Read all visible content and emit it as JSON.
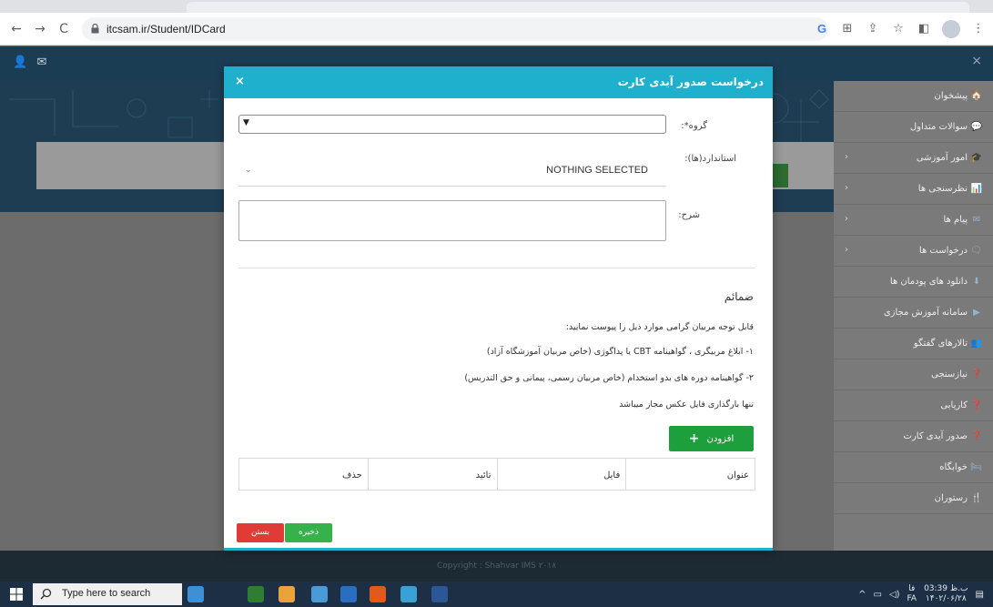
{
  "browser": {
    "url": "itcsam.ir/Student/IDCard",
    "nav": {
      "back": "←",
      "forward": "→",
      "reload": "C"
    },
    "toolbar_icons": [
      "G",
      "⊞",
      "⇪",
      "☆",
      "◧",
      "",
      "⋮"
    ]
  },
  "header": {
    "icons": [
      "👤",
      "✉"
    ]
  },
  "sidebar": {
    "close": "×",
    "items": [
      {
        "label": "پیشخوان",
        "icon": "home-icon",
        "glyph": "🏠",
        "chevron": ""
      },
      {
        "label": "سوالات متداول",
        "icon": "chat-icon",
        "glyph": "💬",
        "chevron": ""
      },
      {
        "label": "امور آموزشی",
        "icon": "graduation-icon",
        "glyph": "🎓",
        "chevron": "‹"
      },
      {
        "label": "نظرسنجی ها",
        "icon": "bar-chart-icon",
        "glyph": "📊",
        "chevron": "‹"
      },
      {
        "label": "پیام ها",
        "icon": "envelope-icon",
        "glyph": "✉",
        "chevron": "‹"
      },
      {
        "label": "درخواست ها",
        "icon": "comment-icon",
        "glyph": "🗨",
        "chevron": "‹"
      },
      {
        "label": "دانلود های پودمان ها",
        "icon": "download-icon",
        "glyph": "⬇",
        "chevron": ""
      },
      {
        "label": "سامانه آموزش مجازی",
        "icon": "play-circle-icon",
        "glyph": "▶",
        "chevron": ""
      },
      {
        "label": "تالارهای گفتگو",
        "icon": "users-icon",
        "glyph": "👥",
        "chevron": ""
      },
      {
        "label": "نیازسنجی",
        "icon": "question-circle-icon",
        "glyph": "❓",
        "chevron": ""
      },
      {
        "label": "کاریابی",
        "icon": "question-circle-icon",
        "glyph": "❓",
        "chevron": ""
      },
      {
        "label": "صدور آیدی کارت",
        "icon": "question-circle-icon",
        "glyph": "❓",
        "chevron": ""
      },
      {
        "label": "خوابگاه",
        "icon": "bed-icon",
        "glyph": "🛏",
        "chevron": ""
      },
      {
        "label": "رستوران",
        "icon": "cutlery-icon",
        "glyph": "🍴",
        "chevron": ""
      }
    ]
  },
  "modal": {
    "title": "درخواست صدور آیدی کارت",
    "close": "×",
    "group_label": "گروه*:",
    "group_value": "",
    "standards_label": "استاندارد(ها):",
    "standards_value": "NOTHING SELECTED",
    "description_label": "شرح:",
    "attachments_title": "ضمائم",
    "notes": [
      "قابل توجه مربیان گرامی موارد ذیل را پیوست نمایید:",
      "۱- ابلاغ مربیگری ، گواهینامه CBT یا پداگوژی (خاص مربیان آموزشگاه آزاد)",
      "۲- گواهینامه دوره های بدو استخدام (خاص مربیان رسمی، پیمانی و حق التدریس)",
      "تنها بارگذاری فایل عکس مجاز میباشد"
    ],
    "add_button": "افزودن",
    "table_headers": [
      "عنوان",
      "فایل",
      "تائید",
      "حذف"
    ],
    "save_button": "ذخیره",
    "close_button": "بستن"
  },
  "footer": {
    "copyright": "Copyright : Shahvar IMS ۲۰۱۸"
  },
  "taskbar": {
    "search_placeholder": "Type here to search",
    "time": "03:39 ب.ظ",
    "date": "۱۴۰۲/۰۶/۲۸",
    "lang_top": "فا",
    "lang_bottom": "FA",
    "apps": [
      "#3f8fd6",
      "#2e7d32",
      "#e8a33a",
      "#4a9ad8",
      "#2a6ebf",
      "#e05a1e",
      "#3aa0d6",
      "#2b5797"
    ]
  },
  "colors": {
    "accent": "#1eb0cd",
    "success": "#35b24a",
    "danger": "#e03b36",
    "header": "#1b3d54"
  }
}
